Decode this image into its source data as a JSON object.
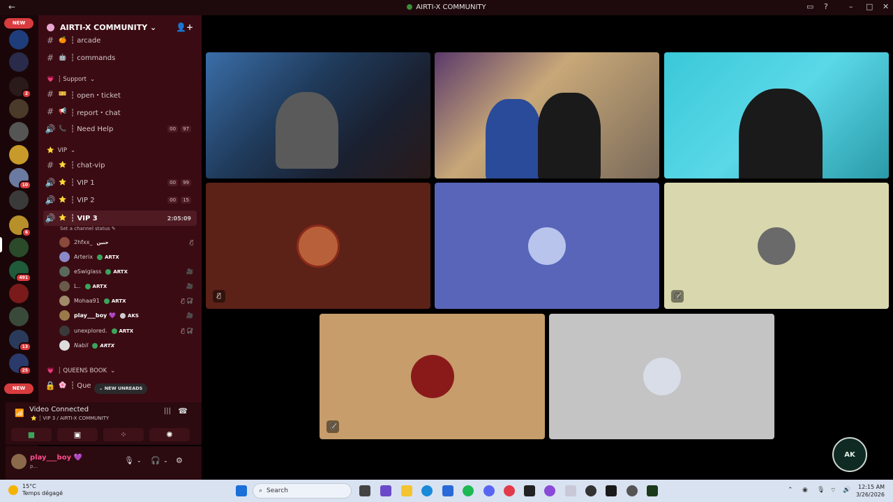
{
  "window": {
    "title": "AIRTI-X COMMUNITY"
  },
  "server_rail": {
    "new_top": "NEW",
    "new_bottom": "NEW",
    "badges": [
      "2",
      "10",
      "6",
      "491",
      "13",
      "25"
    ]
  },
  "server": {
    "name": "AIRTI-X COMMUNITY",
    "chevron": "⌄"
  },
  "channels": {
    "top": [
      {
        "icon": "#",
        "emoji": "🍊",
        "label": "┆ arcade"
      },
      {
        "icon": "#",
        "emoji": "🤖",
        "label": "┆ commands"
      }
    ],
    "support_category": "┆ Support",
    "support": [
      {
        "icon": "#",
        "emoji": "🎫",
        "label": "┆ open・ticket"
      },
      {
        "icon": "#",
        "emoji": "📢",
        "label": "┆ report・chat"
      },
      {
        "icon": "🔊",
        "emoji": "📞",
        "label": "┆ Need Help",
        "c1": "00",
        "c2": "97"
      }
    ],
    "vip_category": "VIP",
    "vip": [
      {
        "icon": "#",
        "emoji": "⭐",
        "label": "┆ chat-vip"
      },
      {
        "icon": "🔊",
        "emoji": "⭐",
        "label": "┆ VIP 1",
        "c1": "00",
        "c2": "99"
      },
      {
        "icon": "🔊",
        "emoji": "⭐",
        "label": "┆ VIP 2",
        "c1": "00",
        "c2": "15"
      },
      {
        "icon": "🔊",
        "emoji": "⭐",
        "label": "┆ VIP 3",
        "time": "2:05:09"
      }
    ],
    "status_hint": "Set a channel status",
    "members": [
      {
        "name": "2hfxx_",
        "tag": "حنين",
        "icons": "🎙̸ "
      },
      {
        "name": "Arterix",
        "tag": "ARTX",
        "icons": ""
      },
      {
        "name": "eSwiglass",
        "tag": "ARTX",
        "icons": "🎥"
      },
      {
        "name": "L..",
        "tag": "ARTX",
        "icons": "🎥"
      },
      {
        "name": "Mohaa91",
        "tag": "ARTX",
        "icons": "🎙̸ 🎧̸"
      },
      {
        "name": "play___boy 💜",
        "tag": "AKS",
        "icons": "🎥"
      },
      {
        "name": "unexplored.",
        "tag": "ARTX",
        "icons": "🎙̸ 🎧̸"
      },
      {
        "name": "Nabil",
        "tag": "ARTX",
        "icons": ""
      }
    ],
    "queens_category": "┆ QUEENS BOOK",
    "queens_partial": "┆ Que",
    "new_unreads": "NEW UNREADS"
  },
  "voice_panel": {
    "status": "Video Connected",
    "channel": "┆ VIP 3 / AIRTI-X COMMUNITY"
  },
  "user_panel": {
    "name": "play___boy 💜",
    "status": "p..."
  },
  "tiles": {
    "colors": [
      "#5c2117",
      "#5865b8",
      "#d9d7ae",
      "#c79d6b",
      "#c4c4c4"
    ],
    "speaking_tile": "top-right camera"
  },
  "overlay_logo": "AK",
  "taskbar": {
    "weather_temp": "15°C",
    "weather_desc": "Temps dégagé",
    "search_placeholder": "Search",
    "time": "12:15 AM",
    "date": "3/26/2026"
  }
}
